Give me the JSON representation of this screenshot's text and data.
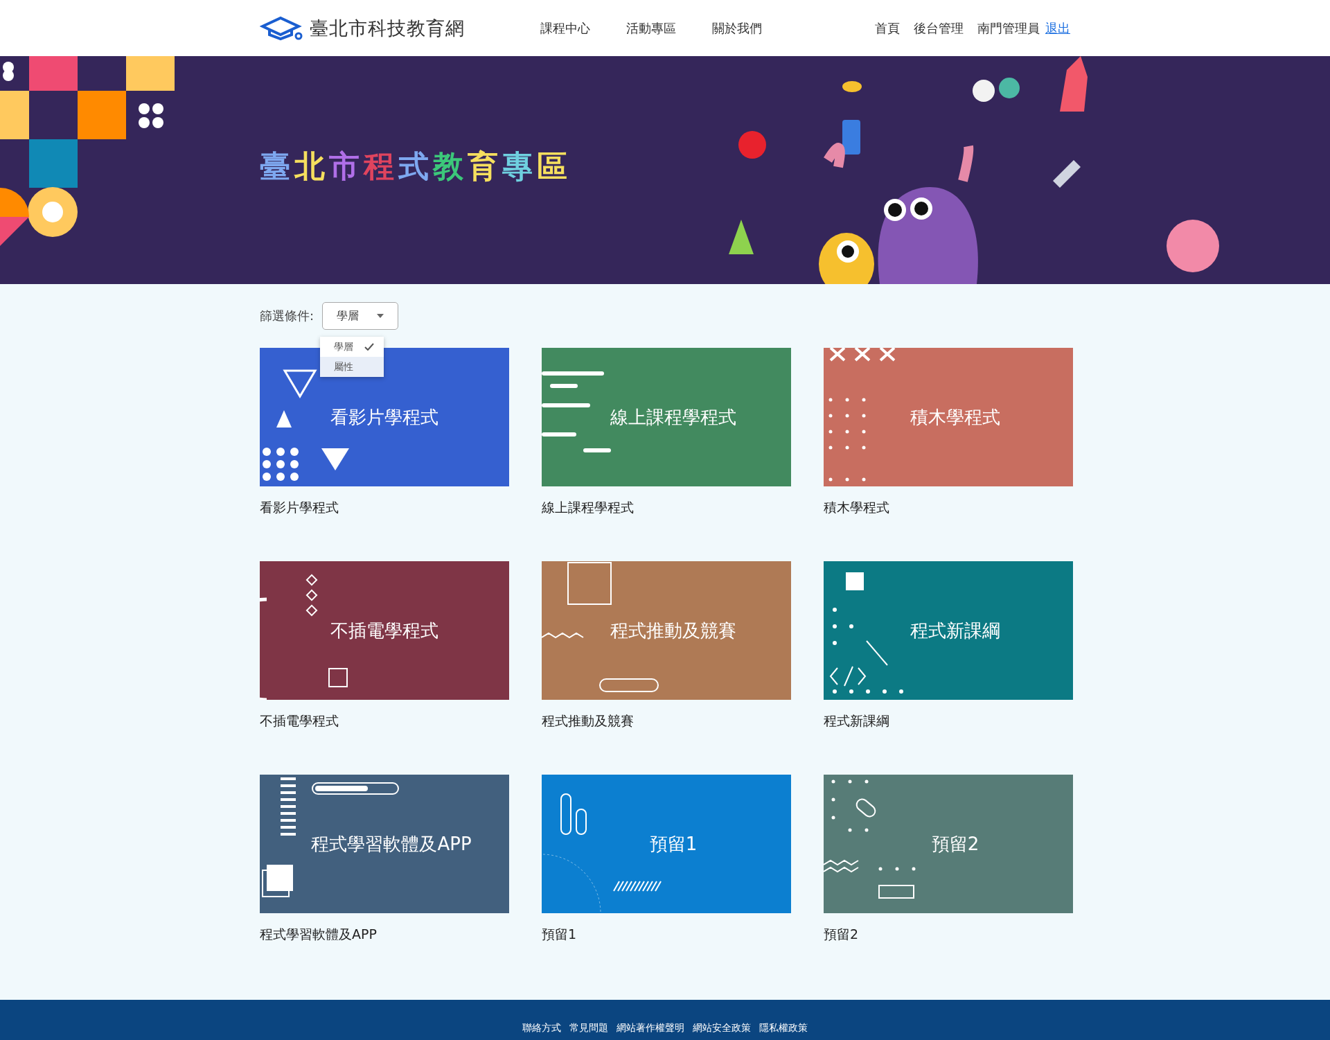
{
  "header": {
    "site_name": "臺北市科技教育網",
    "nav": [
      "課程中心",
      "活動專區",
      "關於我們"
    ],
    "links": [
      "首頁",
      "後台管理"
    ],
    "user": "南門管理員",
    "logout": "退出"
  },
  "banner": {
    "title": "臺北市程式教育專區"
  },
  "filter": {
    "label": "篩選條件:",
    "value": "學層",
    "expanded": true,
    "options": [
      {
        "label": "學層",
        "selected": true,
        "hovered": false
      },
      {
        "label": "屬性",
        "selected": false,
        "hovered": true
      }
    ]
  },
  "cards": [
    {
      "title": "看影片學程式",
      "caption": "看影片學程式",
      "color": "#3560d0",
      "kind": "shapes"
    },
    {
      "title": "線上課程學程式",
      "caption": "線上課程學程式",
      "color": "#428a5f",
      "kind": "code"
    },
    {
      "title": "積木學程式",
      "caption": "積木學程式",
      "color": "#c86e60",
      "kind": "crosses"
    },
    {
      "title": "不插電學程式",
      "caption": "不插電學程式",
      "color": "#7f3546",
      "kind": "arc"
    },
    {
      "title": "程式推動及競賽",
      "caption": "程式推動及競賽",
      "color": "#af7a55",
      "kind": "frame"
    },
    {
      "title": "程式新課綱",
      "caption": "程式新課綱",
      "color": "#0c7a84",
      "kind": "tags"
    },
    {
      "title": "程式學習軟體及APP",
      "caption": "程式學習軟體及APP",
      "color": "#42607e",
      "kind": "bars"
    },
    {
      "title": "預留1",
      "caption": "預留1",
      "color": "#0c7fd0",
      "kind": "pills"
    },
    {
      "title": "預留2",
      "caption": "預留2",
      "color": "#577c77",
      "kind": "wave"
    }
  ],
  "footer": {
    "links": [
      "聯絡方式",
      "常見問題",
      "網站著作權聲明",
      "網站安全政策",
      "隱私權政策"
    ]
  }
}
